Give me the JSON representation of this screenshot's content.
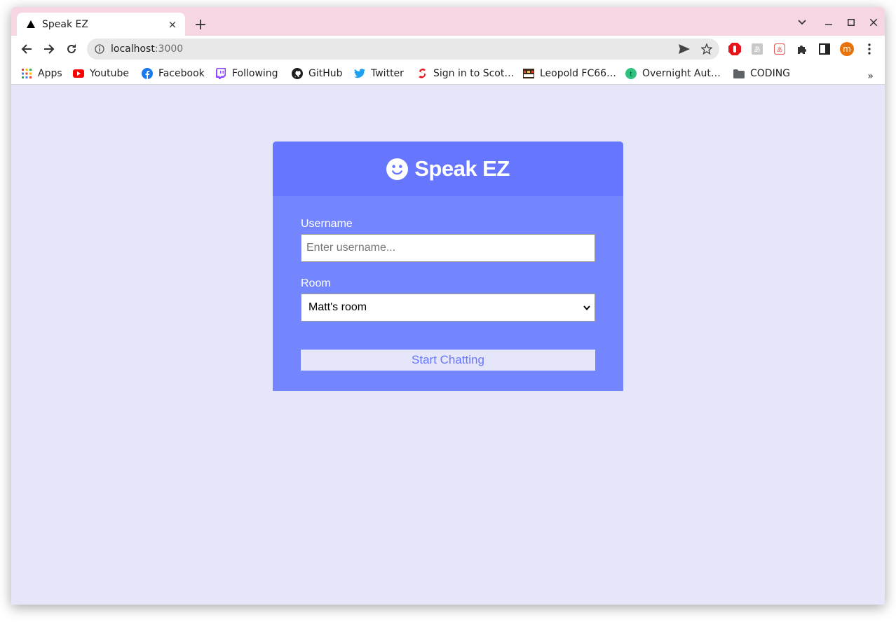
{
  "browser": {
    "tab": {
      "title": "Speak EZ",
      "favicon": "triangle-icon",
      "close": "×"
    },
    "newtab": "+",
    "address": {
      "host": "localhost",
      "port": ":3000"
    },
    "bookmarks": [
      {
        "label": "Apps",
        "icon": "apps-grid-icon"
      },
      {
        "label": "Youtube",
        "icon": "youtube-icon"
      },
      {
        "label": "Facebook",
        "icon": "facebook-icon"
      },
      {
        "label": "Following",
        "icon": "twitch-icon"
      },
      {
        "label": "GitHub",
        "icon": "github-icon"
      },
      {
        "label": "Twitter",
        "icon": "twitter-icon"
      },
      {
        "label": "Sign in to Scot…",
        "icon": "scotiabank-icon"
      },
      {
        "label": "Leopold FC66…",
        "icon": "leopold-icon"
      },
      {
        "label": "Overnight Aut…",
        "icon": "overnight-icon"
      },
      {
        "label": "CODING",
        "icon": "folder-icon"
      }
    ],
    "bookmarks_more": "»",
    "profile_initial": "m"
  },
  "colors": {
    "tabstrip": "#f7d6e3",
    "page_bg": "#e6e6fa",
    "card_header": "#6776ff",
    "card_body": "#7386ff",
    "button_text": "#6776ff",
    "profile": "#e8710a"
  },
  "app": {
    "title": "Speak EZ",
    "logo_icon": "smile-icon",
    "username": {
      "label": "Username",
      "placeholder": "Enter username..."
    },
    "room": {
      "label": "Room",
      "selected": "Matt's room"
    },
    "submit_label": "Start Chatting"
  }
}
